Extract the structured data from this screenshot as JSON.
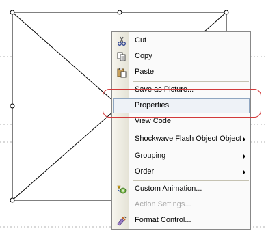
{
  "menu": {
    "items": [
      {
        "label": "Cut",
        "icon": "scissors-icon"
      },
      {
        "label": "Copy",
        "icon": "copy-icon"
      },
      {
        "label": "Paste",
        "icon": "paste-icon"
      },
      {
        "label": "Save as Picture..."
      },
      {
        "label": "Properties",
        "highlighted": true
      },
      {
        "label": "View Code"
      },
      {
        "label": "Shockwave Flash Object Object",
        "submenu": true
      },
      {
        "label": "Grouping",
        "submenu": true
      },
      {
        "label": "Order",
        "submenu": true
      },
      {
        "label": "Custom Animation...",
        "icon": "custom-animation-icon"
      },
      {
        "label": "Action Settings...",
        "disabled": true
      },
      {
        "label": "Format Control...",
        "icon": "format-control-icon"
      }
    ]
  },
  "colors": {
    "highlight_ring": "#d23a3a",
    "hover_border": "#8fa6c1",
    "hover_fill": "#eef2f7"
  }
}
